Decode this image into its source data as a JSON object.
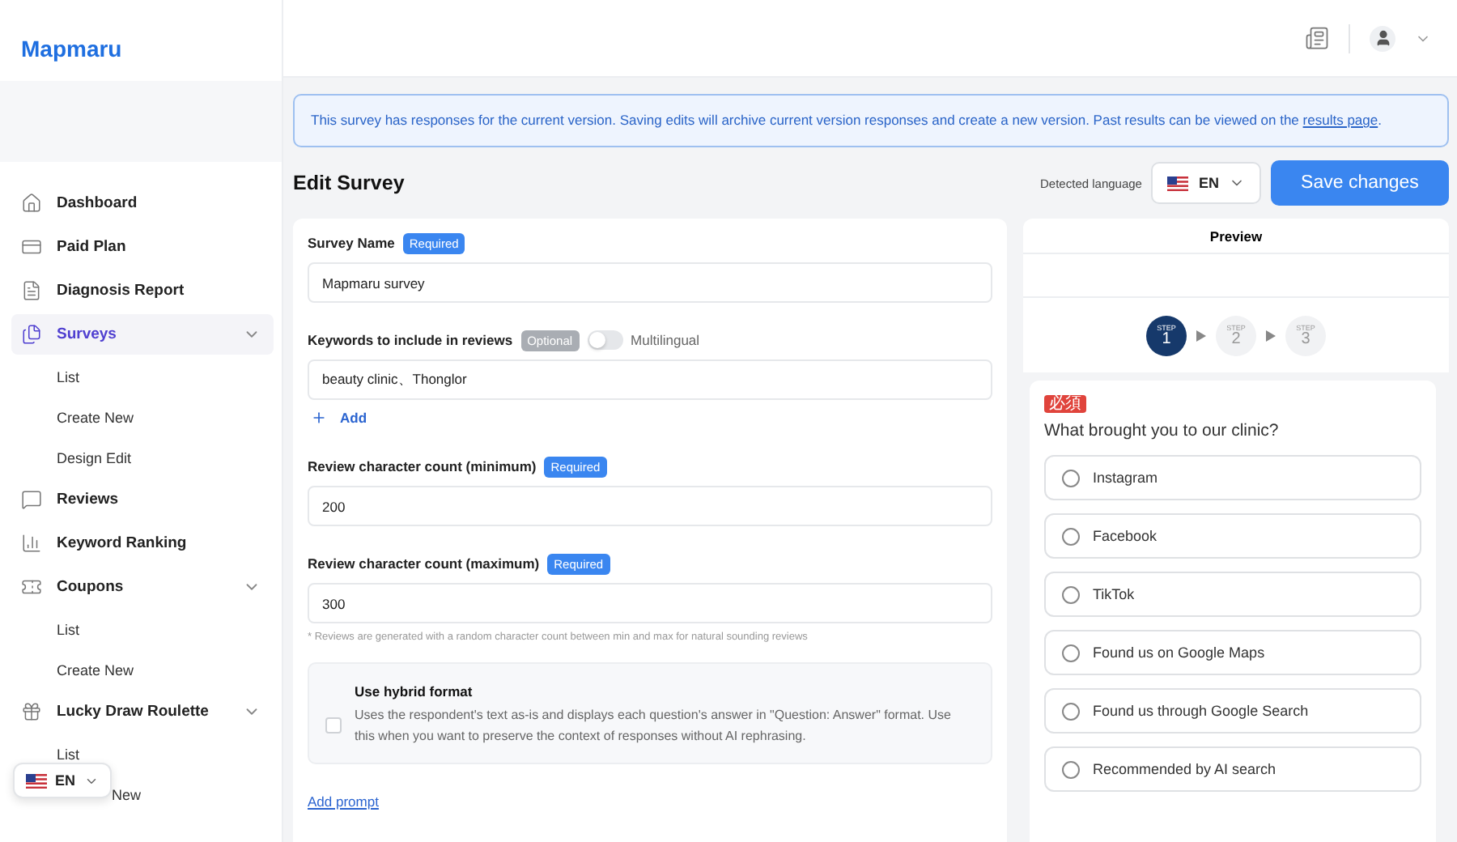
{
  "sidebar": {
    "brand": "Mapmaru",
    "items": [
      {
        "label": "Dashboard",
        "selected": false
      },
      {
        "label": "Paid Plan",
        "selected": false
      },
      {
        "label": "Diagnosis Report",
        "selected": false
      },
      {
        "label": "Surveys",
        "selected": true,
        "expanded": true,
        "children": [
          {
            "label": "List"
          },
          {
            "label": "Create New"
          },
          {
            "label": "Design Edit"
          }
        ]
      },
      {
        "label": "Reviews",
        "selected": false
      },
      {
        "label": "Keyword Ranking",
        "selected": false
      },
      {
        "label": "Coupons",
        "selected": false,
        "expanded": true,
        "children": [
          {
            "label": "List"
          },
          {
            "label": "Create New"
          }
        ]
      },
      {
        "label": "Lucky Draw Roulette",
        "selected": false,
        "expanded": true,
        "children": [
          {
            "label": "List"
          },
          {
            "label": "New",
            "partly_covered": true
          }
        ]
      }
    ],
    "language": "EN"
  },
  "notice": {
    "text": "This survey has responses for the current version. Saving edits will archive current version responses and create a new version. Past results can be viewed on the",
    "link": "results page",
    "end": "."
  },
  "page_title": "Edit Survey",
  "detected_language": {
    "label": "Detected language",
    "value": "EN"
  },
  "save_button": "Save changes",
  "form": {
    "survey_name": {
      "label": "Survey Name",
      "badge": "Required",
      "value": "Mapmaru survey"
    },
    "keywords": {
      "label": "Keywords to include in reviews",
      "badge": "Optional",
      "toggle_label": "Multilingual",
      "toggle_on": false,
      "value": "beauty clinic、Thonglor",
      "add": "Add"
    },
    "min_count": {
      "label": "Review character count (minimum)",
      "badge": "Required",
      "value": "200"
    },
    "max_count": {
      "label": "Review character count (maximum)",
      "badge": "Required",
      "value": "300"
    },
    "note": "* Reviews are generated with a random character count between min and max for natural sounding reviews",
    "hybrid": {
      "title": "Use hybrid format",
      "checked": false,
      "description": "Uses the respondent's text as-is and displays each question's answer in \"Question: Answer\" format. Use this when you want to preserve the context of responses without AI rephrasing."
    },
    "add_prompt": "Add prompt"
  },
  "preview": {
    "title": "Preview",
    "steps": [
      {
        "label": "STEP",
        "number": "1",
        "selected": true
      },
      {
        "label": "STEP",
        "number": "2",
        "selected": false
      },
      {
        "label": "STEP",
        "number": "3",
        "selected": false
      }
    ],
    "question": {
      "badge": "必須",
      "text": "What brought you to our clinic?",
      "options": [
        {
          "label": "Instagram",
          "selected": false
        },
        {
          "label": "Facebook",
          "selected": false
        },
        {
          "label": "TikTok",
          "selected": false
        },
        {
          "label": "Found us on Google Maps",
          "selected": false
        },
        {
          "label": "Found us through Google Search",
          "selected": false
        },
        {
          "label": "Recommended by AI search",
          "selected": false
        }
      ]
    }
  }
}
